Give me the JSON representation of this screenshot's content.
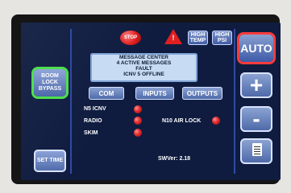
{
  "top_bar": {
    "stop_label": "STOP",
    "high_temp_label": "HIGH TEMP",
    "high_psi_label": "HIGH PSI",
    "auto_label": "AUTO"
  },
  "left_buttons": {
    "boom_lock_bypass": "BOOM LOCK BYPASS",
    "set_time": "SET TIME"
  },
  "right_buttons": {
    "plus": "+",
    "minus": "-"
  },
  "message_center": {
    "title": "MESSAGE CENTER",
    "line1": "4   ACTIVE MESSAGES",
    "line2": "FAULT",
    "line3": "ICNV 5 OFFLINE"
  },
  "tabs": [
    "COM",
    "INPUTS",
    "OUTPUTS"
  ],
  "status": {
    "left_items": [
      {
        "label": "N5 ICNV"
      },
      {
        "label": "RADIO"
      },
      {
        "label": "SKIM"
      }
    ],
    "right_item": {
      "label": "N10 AIR LOCK"
    }
  },
  "software_version": "SWVer: 2.18",
  "colors": {
    "screen_bg": "#0f1c40",
    "accent_red": "#e02020",
    "accent_green": "#4de04d",
    "button_blue": "#4f6aa7"
  }
}
